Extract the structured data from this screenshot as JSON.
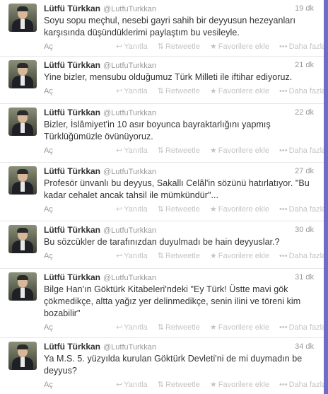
{
  "tweets": [
    {
      "name": "Lütfü Türkkan",
      "handle": "@LutfuTurkkan",
      "time": "19 dk",
      "text": "Soyu sopu meçhul, nesebi gayri sahih bir deyyusun hezeyanları karşısında düşündüklerimi paylaştım bu vesileyle."
    },
    {
      "name": "Lütfü Türkkan",
      "handle": "@LutfuTurkkan",
      "time": "21 dk",
      "text": "Yine bizler, mensubu olduğumuz Türk Milleti ile iftihar ediyoruz."
    },
    {
      "name": "Lütfü Türkkan",
      "handle": "@LutfuTurkkan",
      "time": "22 dk",
      "text": "Bizler, İslâmiyet'in 10 asır boyunca bayraktarlığını yapmış Türklüğümüzle övünüyoruz."
    },
    {
      "name": "Lütfü Türkkan",
      "handle": "@LutfuTurkkan",
      "time": "27 dk",
      "text": "Profesör ünvanlı bu deyyus, Sakallı Celâl'in sözünü hatırlatıyor. \"Bu kadar cehalet ancak tahsil ile mümkündür\"..."
    },
    {
      "name": "Lütfü Türkkan",
      "handle": "@LutfuTurkkan",
      "time": "30 dk",
      "text": "Bu sözcükler de tarafınızdan duyulmadı be hain deyyuslar.?"
    },
    {
      "name": "Lütfü Türkkan",
      "handle": "@LutfuTurkkan",
      "time": "31 dk",
      "text": "Bilge Han'ın Göktürk Kitabeleri'ndeki \"Ey Türk! Üstte mavi gök çökmedikçe, altta yağız yer delinmedikçe, senin ilini ve töreni kim bozabilir\""
    },
    {
      "name": "Lütfü Türkkan",
      "handle": "@LutfuTurkkan",
      "time": "34 dk",
      "text": "Ya M.S. 5. yüzyılda kurulan Göktürk Devleti'ni de mi duymadın be deyyus?"
    }
  ],
  "actions": {
    "expand": "Aç",
    "reply": "Yanıtla",
    "retweet": "Retweetle",
    "favorite": "Favorilere ekle",
    "more": "Daha fazla"
  },
  "colors": {
    "accent_bar": "#6f6bc7",
    "action_gray": "#c4c4c4",
    "text": "#333333"
  }
}
